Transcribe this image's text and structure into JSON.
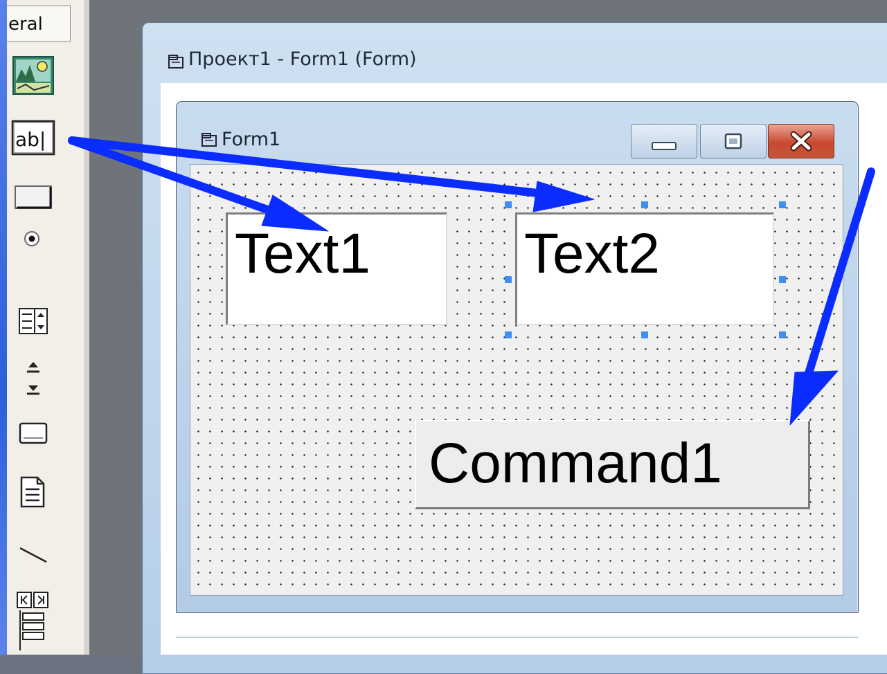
{
  "toolbox": {
    "tab_label": "eral",
    "tools": [
      {
        "name": "picturebox-tool-icon"
      },
      {
        "name": "textbox-tool-icon",
        "label": "ab|"
      },
      {
        "name": "commandbutton-tool-icon"
      },
      {
        "name": "optionbutton-tool-icon"
      },
      {
        "name": "combobox-tool-icon"
      },
      {
        "name": "vscrollbar-tool-icon"
      },
      {
        "name": "drivelistbox-tool-icon"
      },
      {
        "name": "filelistbox-tool-icon"
      },
      {
        "name": "line-tool-icon"
      },
      {
        "name": "data-tool-icon"
      }
    ]
  },
  "mdi_window": {
    "title": "Проект1 - Form1 (Form)"
  },
  "form": {
    "title": "Form1",
    "controls": {
      "text1": "Text1",
      "text2": "Text2",
      "command1": "Command1"
    }
  },
  "colors": {
    "arrow": "#0a2cff",
    "selection_handle": "#3f8ff0",
    "close_button": "#c84930"
  }
}
